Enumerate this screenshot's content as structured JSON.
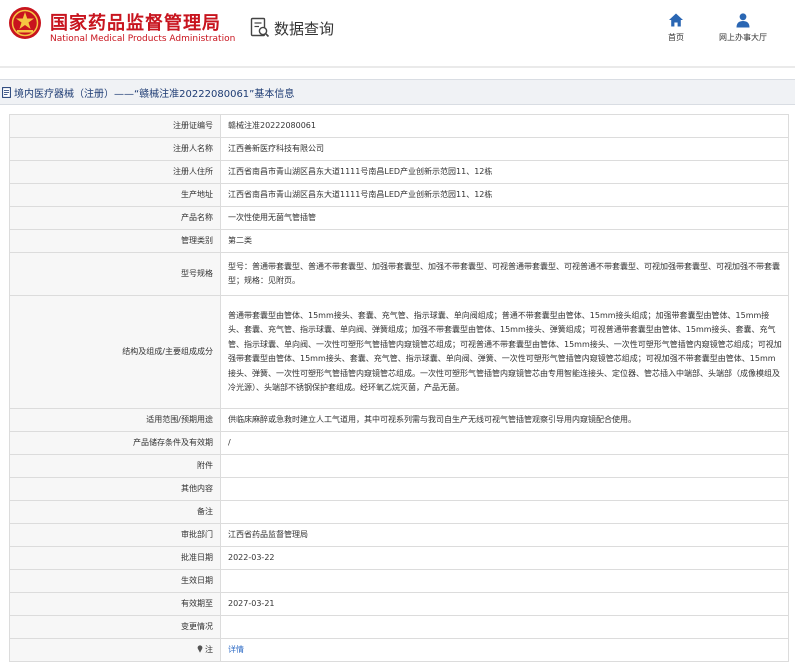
{
  "header": {
    "brand_cn": "国家药品监督管理局",
    "brand_en": "National Medical Products Administration",
    "query_label": "数据查询",
    "nav": [
      {
        "label": "首页",
        "icon": "home-icon"
      },
      {
        "label": "网上办事大厅",
        "icon": "user-icon"
      }
    ]
  },
  "colors": {
    "brand_red": "#c8141e",
    "title_blue": "#1d3b73",
    "nav_blue": "#2a66b3",
    "link_blue": "#2e6bc6"
  },
  "breadcrumb": {
    "text": "境内医疗器械（注册）——“赣械注准20222080061”基本信息"
  },
  "detail": {
    "rows": [
      {
        "label": "注册证编号",
        "value": "赣械注准20222080061"
      },
      {
        "label": "注册人名称",
        "value": "江西善新医疗科技有限公司"
      },
      {
        "label": "注册人住所",
        "value": "江西省南昌市青山湖区昌东大道1111号南昌LED产业创新示范园11、12栋"
      },
      {
        "label": "生产地址",
        "value": "江西省南昌市青山湖区昌东大道1111号南昌LED产业创新示范园11、12栋"
      },
      {
        "label": "产品名称",
        "value": "一次性使用无菌气管插管"
      },
      {
        "label": "管理类别",
        "value": "第二类"
      },
      {
        "label": "型号规格",
        "value": "型号：普通带套囊型、普通不带套囊型、加强带套囊型、加强不带套囊型、可视普通带套囊型、可视普通不带套囊型、可视加强带套囊型、可视加强不带套囊型；规格：见附页。"
      },
      {
        "label": "结构及组成/主要组成成分",
        "value": "普通带套囊型由管体、15mm接头、套囊、充气管、指示球囊、单向阀组成；普通不带套囊型由管体、15mm接头组成；加强带套囊型由管体、15mm接头、套囊、充气管、指示球囊、单向阀、弹簧组成；加强不带套囊型由管体、15mm接头、弹簧组成；可视普通带套囊型由管体、15mm接头、套囊、充气管、指示球囊、单向阀、一次性可塑形气管插管内窥镜管芯组成；可视普通不带套囊型由管体、15mm接头、一次性可塑形气管插管内窥镜管芯组成；可视加强带套囊型由管体、15mm接头、套囊、充气管、指示球囊、单向阀、弹簧、一次性可塑形气管插管内窥镜管芯组成；可视加强不带套囊型由管体、15mm接头、弹簧、一次性可塑形气管插管内窥镜管芯组成。一次性可塑形气管插管内窥镜管芯由专用智能连接头、定位器、管芯插入中端部、头端部（成像模组及冷光源）、头端部不锈钢保护套组成。经环氧乙烷灭菌，产品无菌。"
      },
      {
        "label": "适用范围/预期用途",
        "value": "供临床麻醉或急救时建立人工气道用，其中可视系列需与我司自生产无线可视气管插管观察引导用内窥镜配合使用。"
      },
      {
        "label": "产品储存条件及有效期",
        "value": "/"
      },
      {
        "label": "附件",
        "value": ""
      },
      {
        "label": "其他内容",
        "value": ""
      },
      {
        "label": "备注",
        "value": ""
      },
      {
        "label": "审批部门",
        "value": "江西省药品监督管理局"
      },
      {
        "label": "批准日期",
        "value": "2022-03-22"
      },
      {
        "label": "生效日期",
        "value": ""
      },
      {
        "label": "有效期至",
        "value": "2027-03-21"
      },
      {
        "label": "变更情况",
        "value": ""
      },
      {
        "label": "注",
        "value": "详情",
        "icon": "pin-icon"
      }
    ]
  }
}
